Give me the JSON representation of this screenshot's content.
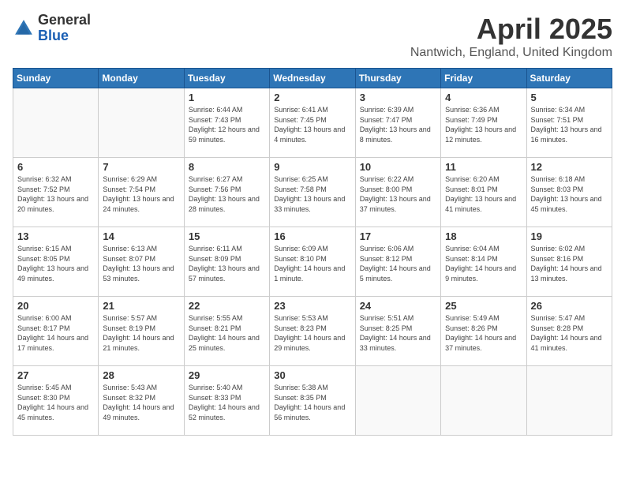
{
  "header": {
    "logo_general": "General",
    "logo_blue": "Blue",
    "title": "April 2025",
    "subtitle": "Nantwich, England, United Kingdom"
  },
  "days_of_week": [
    "Sunday",
    "Monday",
    "Tuesday",
    "Wednesday",
    "Thursday",
    "Friday",
    "Saturday"
  ],
  "weeks": [
    [
      {
        "day": "",
        "info": ""
      },
      {
        "day": "",
        "info": ""
      },
      {
        "day": "1",
        "info": "Sunrise: 6:44 AM\nSunset: 7:43 PM\nDaylight: 12 hours and 59 minutes."
      },
      {
        "day": "2",
        "info": "Sunrise: 6:41 AM\nSunset: 7:45 PM\nDaylight: 13 hours and 4 minutes."
      },
      {
        "day": "3",
        "info": "Sunrise: 6:39 AM\nSunset: 7:47 PM\nDaylight: 13 hours and 8 minutes."
      },
      {
        "day": "4",
        "info": "Sunrise: 6:36 AM\nSunset: 7:49 PM\nDaylight: 13 hours and 12 minutes."
      },
      {
        "day": "5",
        "info": "Sunrise: 6:34 AM\nSunset: 7:51 PM\nDaylight: 13 hours and 16 minutes."
      }
    ],
    [
      {
        "day": "6",
        "info": "Sunrise: 6:32 AM\nSunset: 7:52 PM\nDaylight: 13 hours and 20 minutes."
      },
      {
        "day": "7",
        "info": "Sunrise: 6:29 AM\nSunset: 7:54 PM\nDaylight: 13 hours and 24 minutes."
      },
      {
        "day": "8",
        "info": "Sunrise: 6:27 AM\nSunset: 7:56 PM\nDaylight: 13 hours and 28 minutes."
      },
      {
        "day": "9",
        "info": "Sunrise: 6:25 AM\nSunset: 7:58 PM\nDaylight: 13 hours and 33 minutes."
      },
      {
        "day": "10",
        "info": "Sunrise: 6:22 AM\nSunset: 8:00 PM\nDaylight: 13 hours and 37 minutes."
      },
      {
        "day": "11",
        "info": "Sunrise: 6:20 AM\nSunset: 8:01 PM\nDaylight: 13 hours and 41 minutes."
      },
      {
        "day": "12",
        "info": "Sunrise: 6:18 AM\nSunset: 8:03 PM\nDaylight: 13 hours and 45 minutes."
      }
    ],
    [
      {
        "day": "13",
        "info": "Sunrise: 6:15 AM\nSunset: 8:05 PM\nDaylight: 13 hours and 49 minutes."
      },
      {
        "day": "14",
        "info": "Sunrise: 6:13 AM\nSunset: 8:07 PM\nDaylight: 13 hours and 53 minutes."
      },
      {
        "day": "15",
        "info": "Sunrise: 6:11 AM\nSunset: 8:09 PM\nDaylight: 13 hours and 57 minutes."
      },
      {
        "day": "16",
        "info": "Sunrise: 6:09 AM\nSunset: 8:10 PM\nDaylight: 14 hours and 1 minute."
      },
      {
        "day": "17",
        "info": "Sunrise: 6:06 AM\nSunset: 8:12 PM\nDaylight: 14 hours and 5 minutes."
      },
      {
        "day": "18",
        "info": "Sunrise: 6:04 AM\nSunset: 8:14 PM\nDaylight: 14 hours and 9 minutes."
      },
      {
        "day": "19",
        "info": "Sunrise: 6:02 AM\nSunset: 8:16 PM\nDaylight: 14 hours and 13 minutes."
      }
    ],
    [
      {
        "day": "20",
        "info": "Sunrise: 6:00 AM\nSunset: 8:17 PM\nDaylight: 14 hours and 17 minutes."
      },
      {
        "day": "21",
        "info": "Sunrise: 5:57 AM\nSunset: 8:19 PM\nDaylight: 14 hours and 21 minutes."
      },
      {
        "day": "22",
        "info": "Sunrise: 5:55 AM\nSunset: 8:21 PM\nDaylight: 14 hours and 25 minutes."
      },
      {
        "day": "23",
        "info": "Sunrise: 5:53 AM\nSunset: 8:23 PM\nDaylight: 14 hours and 29 minutes."
      },
      {
        "day": "24",
        "info": "Sunrise: 5:51 AM\nSunset: 8:25 PM\nDaylight: 14 hours and 33 minutes."
      },
      {
        "day": "25",
        "info": "Sunrise: 5:49 AM\nSunset: 8:26 PM\nDaylight: 14 hours and 37 minutes."
      },
      {
        "day": "26",
        "info": "Sunrise: 5:47 AM\nSunset: 8:28 PM\nDaylight: 14 hours and 41 minutes."
      }
    ],
    [
      {
        "day": "27",
        "info": "Sunrise: 5:45 AM\nSunset: 8:30 PM\nDaylight: 14 hours and 45 minutes."
      },
      {
        "day": "28",
        "info": "Sunrise: 5:43 AM\nSunset: 8:32 PM\nDaylight: 14 hours and 49 minutes."
      },
      {
        "day": "29",
        "info": "Sunrise: 5:40 AM\nSunset: 8:33 PM\nDaylight: 14 hours and 52 minutes."
      },
      {
        "day": "30",
        "info": "Sunrise: 5:38 AM\nSunset: 8:35 PM\nDaylight: 14 hours and 56 minutes."
      },
      {
        "day": "",
        "info": ""
      },
      {
        "day": "",
        "info": ""
      },
      {
        "day": "",
        "info": ""
      }
    ]
  ]
}
